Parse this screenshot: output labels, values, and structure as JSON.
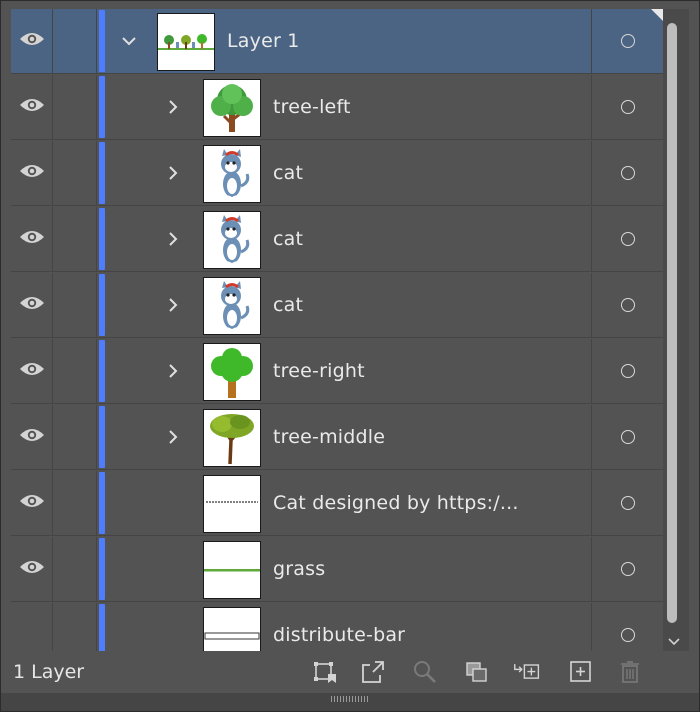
{
  "layers": [
    {
      "name": "Layer 1",
      "selected": true,
      "level": 0,
      "expanded": true,
      "visible": true,
      "thumb": "layer-1-thumbnail"
    },
    {
      "name": "tree-left",
      "selected": false,
      "level": 1,
      "expanded": false,
      "visible": true,
      "thumb": "tree-left-thumbnail"
    },
    {
      "name": "cat",
      "selected": false,
      "level": 1,
      "expanded": false,
      "visible": true,
      "thumb": "cat-thumbnail"
    },
    {
      "name": "cat",
      "selected": false,
      "level": 1,
      "expanded": false,
      "visible": true,
      "thumb": "cat-thumbnail"
    },
    {
      "name": "cat",
      "selected": false,
      "level": 1,
      "expanded": false,
      "visible": true,
      "thumb": "cat-thumbnail"
    },
    {
      "name": "tree-right",
      "selected": false,
      "level": 1,
      "expanded": false,
      "visible": true,
      "thumb": "tree-right-thumbnail"
    },
    {
      "name": "tree-middle",
      "selected": false,
      "level": 1,
      "expanded": false,
      "visible": true,
      "thumb": "tree-middle-thumbnail"
    },
    {
      "name": "Cat designed by https:/...",
      "selected": false,
      "level": 1,
      "expanded": null,
      "visible": true,
      "thumb": "text-thumbnail"
    },
    {
      "name": "grass",
      "selected": false,
      "level": 1,
      "expanded": null,
      "visible": true,
      "thumb": "grass-thumbnail"
    },
    {
      "name": "distribute-bar",
      "selected": false,
      "level": 1,
      "expanded": null,
      "visible": false,
      "thumb": "bar-thumbnail"
    }
  ],
  "footer": {
    "layer_count": "1 Layer",
    "icons": [
      "collect-for-export-icon",
      "export-icon",
      "locate-object-icon",
      "clipping-mask-icon",
      "move-selection-icon",
      "new-sublayer-icon",
      "new-layer-icon",
      "delete-icon"
    ]
  },
  "colors": {
    "layer_color": "#4f7dff",
    "selected_row": "#4b6483",
    "panel_bg": "#535353"
  }
}
